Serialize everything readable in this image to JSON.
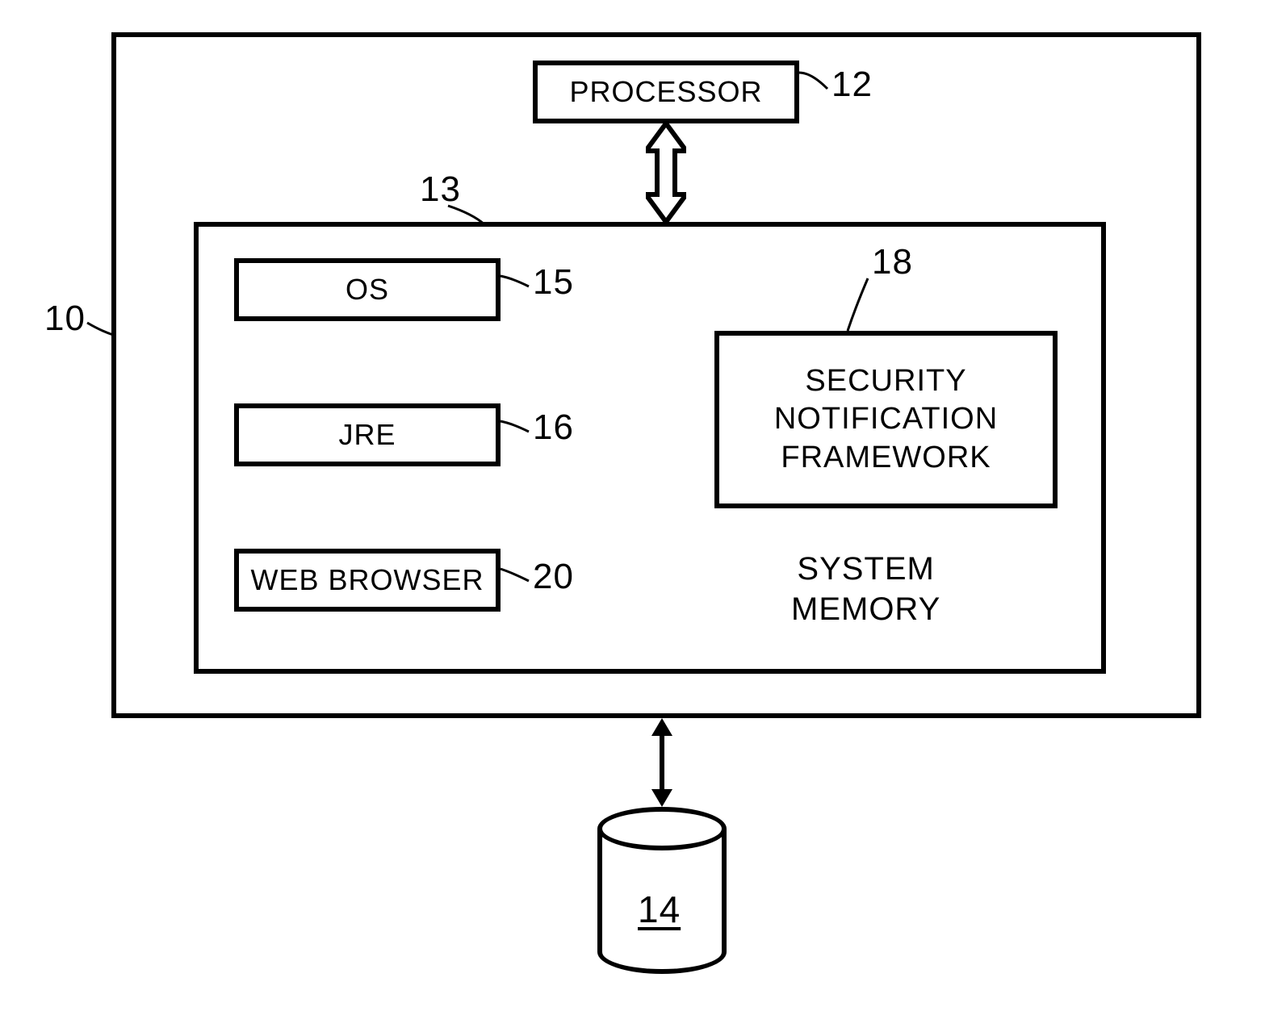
{
  "refs": {
    "outer": "10",
    "processor": "12",
    "sysmem": "13",
    "os": "15",
    "jre": "16",
    "snf": "18",
    "browser": "20",
    "db": "14"
  },
  "blocks": {
    "processor": "PROCESSOR",
    "os": "OS",
    "jre": "JRE",
    "browser": "WEB BROWSER",
    "snf": "SECURITY\nNOTIFICATION\nFRAMEWORK",
    "sysmem_label": "SYSTEM\nMEMORY"
  }
}
